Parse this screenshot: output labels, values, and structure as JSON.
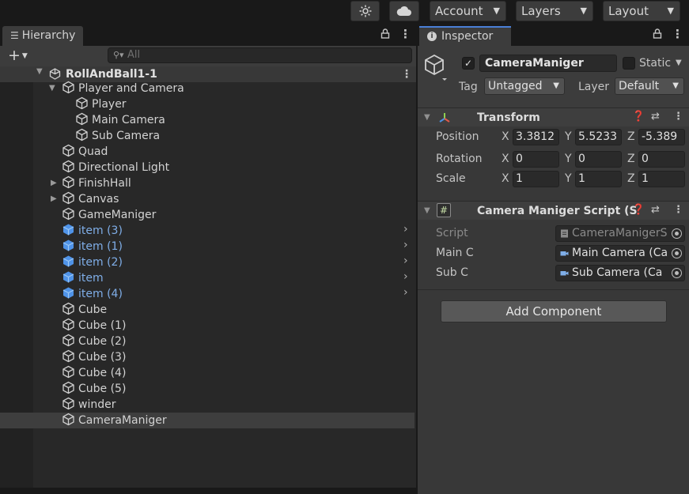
{
  "toolbar": {
    "account_label": "Account",
    "layers_label": "Layers",
    "layout_label": "Layout"
  },
  "hierarchy": {
    "tab_label": "Hierarchy",
    "search_placeholder": "All",
    "scene_name": "RollAndBall1-1",
    "items": [
      {
        "label": "Player and Camera",
        "depth": 1,
        "expanded": true,
        "prefab": false
      },
      {
        "label": "Player",
        "depth": 2,
        "prefab": false
      },
      {
        "label": "Main Camera",
        "depth": 2,
        "prefab": false
      },
      {
        "label": "Sub Camera",
        "depth": 2,
        "prefab": false
      },
      {
        "label": "Quad",
        "depth": 1,
        "prefab": false
      },
      {
        "label": "Directional Light",
        "depth": 1,
        "prefab": false
      },
      {
        "label": "FinishHall",
        "depth": 1,
        "collapsed": true,
        "prefab": false
      },
      {
        "label": "Canvas",
        "depth": 1,
        "collapsed": true,
        "prefab": false
      },
      {
        "label": "GameManiger",
        "depth": 1,
        "prefab": false
      },
      {
        "label": "item (3)",
        "depth": 1,
        "prefab": true
      },
      {
        "label": "item (1)",
        "depth": 1,
        "prefab": true
      },
      {
        "label": "item (2)",
        "depth": 1,
        "prefab": true
      },
      {
        "label": "item",
        "depth": 1,
        "prefab": true
      },
      {
        "label": "item (4)",
        "depth": 1,
        "prefab": true
      },
      {
        "label": "Cube",
        "depth": 1,
        "prefab": false
      },
      {
        "label": "Cube (1)",
        "depth": 1,
        "prefab": false
      },
      {
        "label": "Cube (2)",
        "depth": 1,
        "prefab": false
      },
      {
        "label": "Cube (3)",
        "depth": 1,
        "prefab": false
      },
      {
        "label": "Cube (4)",
        "depth": 1,
        "prefab": false
      },
      {
        "label": "Cube (5)",
        "depth": 1,
        "prefab": false
      },
      {
        "label": "winder",
        "depth": 1,
        "prefab": false
      },
      {
        "label": "CameraManiger",
        "depth": 1,
        "prefab": false,
        "selected": true
      }
    ]
  },
  "inspector": {
    "tab_label": "Inspector",
    "object_name": "CameraManiger",
    "active": true,
    "static_label": "Static",
    "tag_label": "Tag",
    "tag_value": "Untagged",
    "layer_label": "Layer",
    "layer_value": "Default",
    "transform": {
      "title": "Transform",
      "position_label": "Position",
      "rotation_label": "Rotation",
      "scale_label": "Scale",
      "position": {
        "x": "3.3812",
        "y": "5.5233",
        "z": "-5.389"
      },
      "rotation": {
        "x": "0",
        "y": "0",
        "z": "0"
      },
      "scale": {
        "x": "1",
        "y": "1",
        "z": "1"
      }
    },
    "script_component": {
      "title": "Camera Maniger Script (S",
      "script_label": "Script",
      "script_value": "CameraManigerS",
      "main_label": "Main C",
      "main_value": "Main Camera (Ca",
      "sub_label": "Sub C",
      "sub_value": "Sub Camera (Ca"
    },
    "add_component_label": "Add Component"
  },
  "colors": {
    "prefab_blue": "#7faee8",
    "active_tab_accent": "#4a7fd6",
    "panel_dark": "#282828",
    "inspector_bg": "#383838"
  }
}
